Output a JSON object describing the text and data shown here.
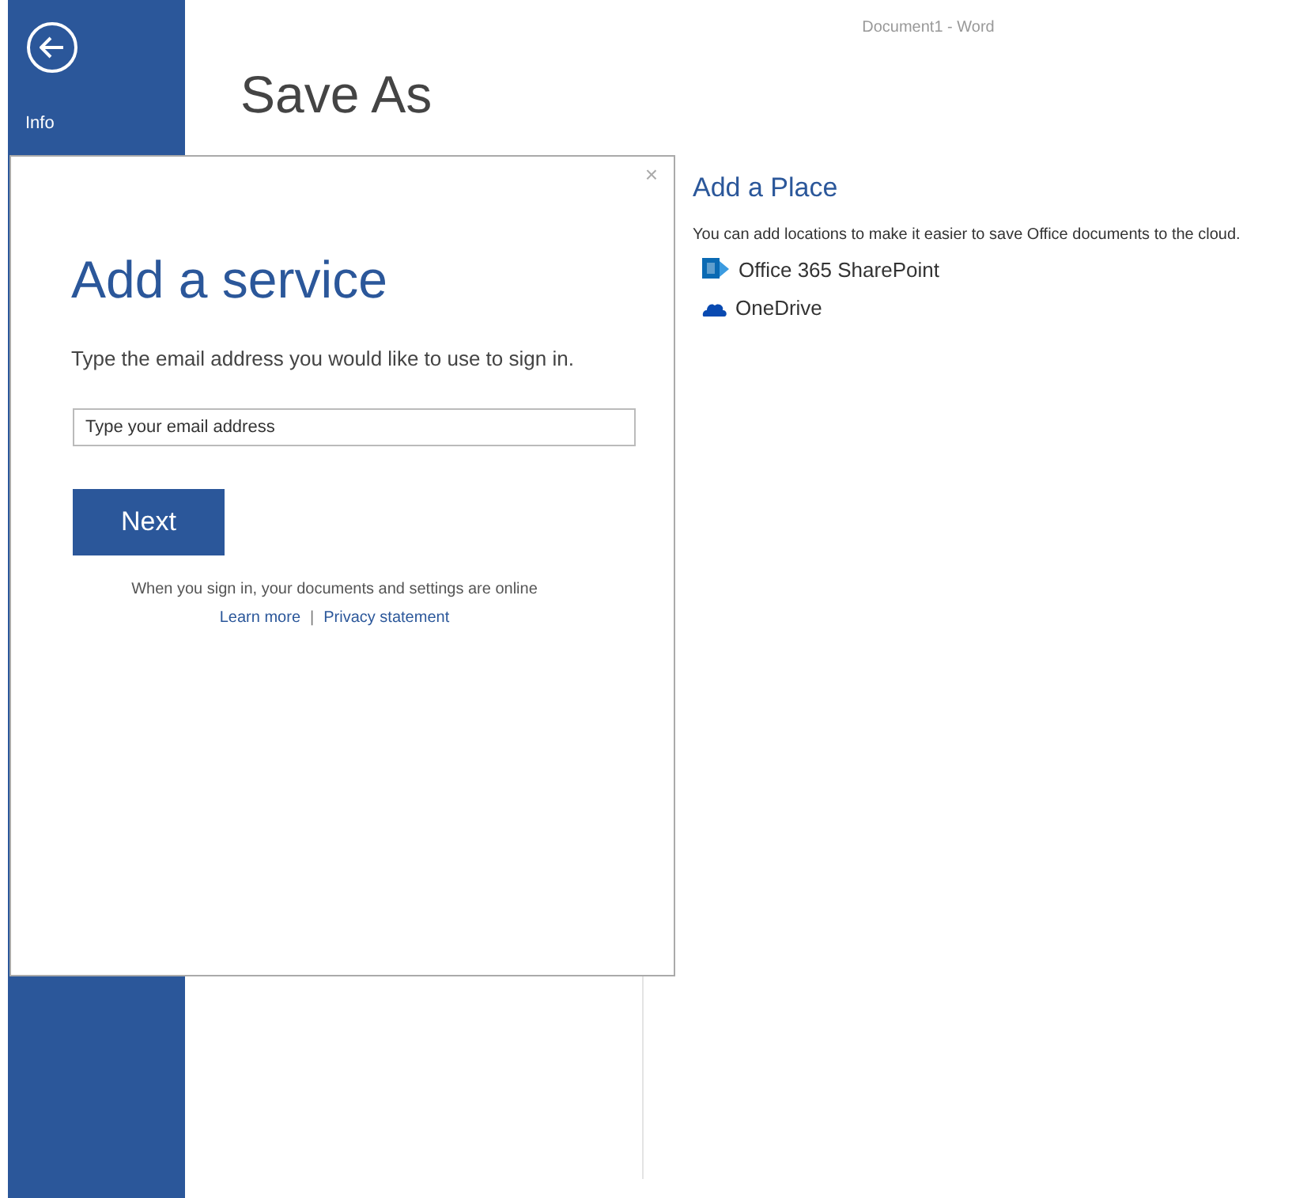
{
  "window": {
    "title": "Document1 - Word"
  },
  "sidebar": {
    "items": [
      {
        "label": "Info",
        "selected": false
      }
    ]
  },
  "page": {
    "title": "Save As"
  },
  "add_place": {
    "title": "Add a Place",
    "description": "You can add locations to make it easier to save Office documents to the cloud.",
    "services": [
      {
        "kind": "sharepoint",
        "label": "Office 365 SharePoint"
      },
      {
        "kind": "onedrive",
        "label": "OneDrive"
      }
    ]
  },
  "dialog": {
    "close": "×",
    "title": "Add a service",
    "prompt": "Type the email address you would like to use to sign in.",
    "email_field": {
      "placeholder": "Type your email address"
    },
    "next_button": "Next",
    "note": "When you sign in, your documents and settings are online",
    "links": [
      "Learn more",
      "Privacy statement"
    ],
    "separator": "|"
  }
}
